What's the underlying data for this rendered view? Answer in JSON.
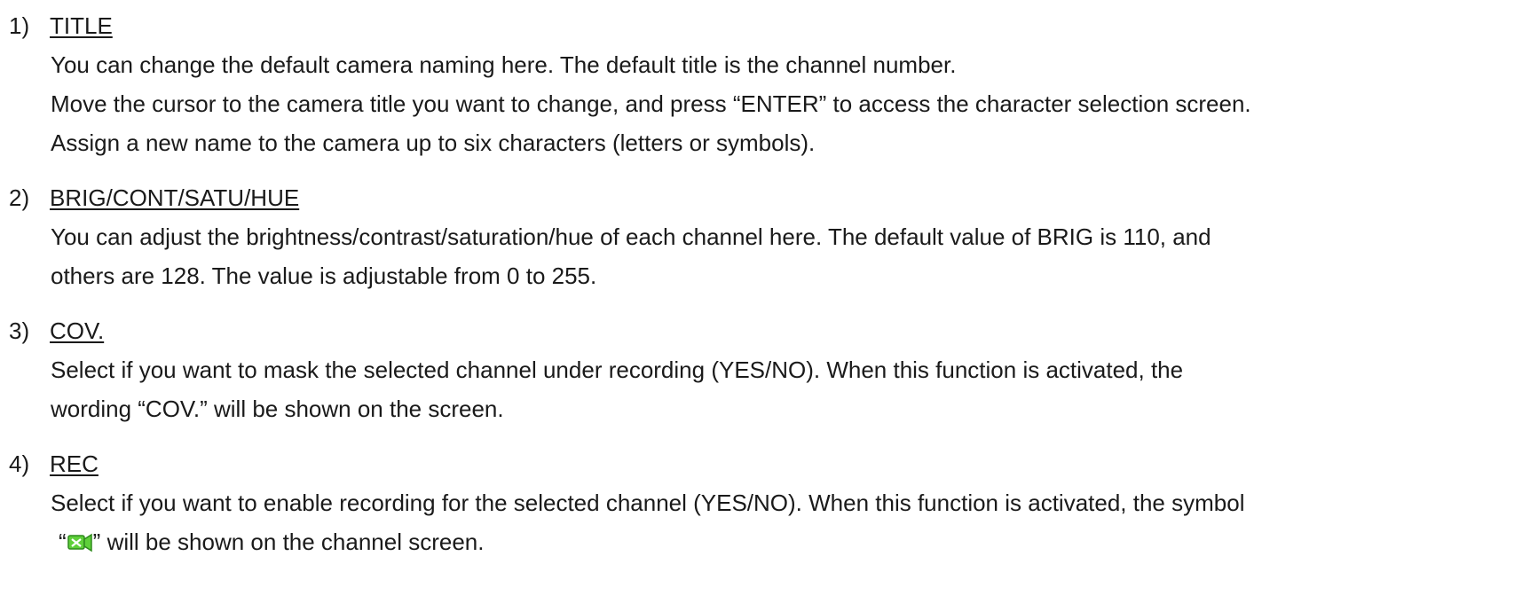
{
  "sections": [
    {
      "number": "1)",
      "heading": "TITLE",
      "lines": [
        "You can change the default camera naming here. The default title is the channel number.",
        "Move the cursor to the camera title you want to change, and press “ENTER” to access the character selection screen.",
        "Assign a new name to the camera up to six characters (letters or symbols)."
      ]
    },
    {
      "number": "2)",
      "heading": "BRIG/CONT/SATU/HUE",
      "lines": [
        "You can adjust the brightness/contrast/saturation/hue of each channel here. The default value of BRIG is 110, and",
        "others are 128. The value is adjustable from 0 to 255."
      ]
    },
    {
      "number": "3)",
      "heading": "COV.",
      "lines": [
        "Select if you want to mask the selected channel under recording (YES/NO). When this function is activated, the",
        "wording “COV.” will be shown on the screen."
      ]
    },
    {
      "number": "4)",
      "heading": "REC",
      "lines": [
        "Select if you want to enable recording for the selected channel (YES/NO). When this function is activated, the symbol"
      ],
      "icon_line": {
        "open_quote": "“",
        "close_quote": "”",
        "after": " will be shown on the channel screen.",
        "icon": "record-camera-icon",
        "icon_color": "#5fd03a"
      }
    }
  ]
}
